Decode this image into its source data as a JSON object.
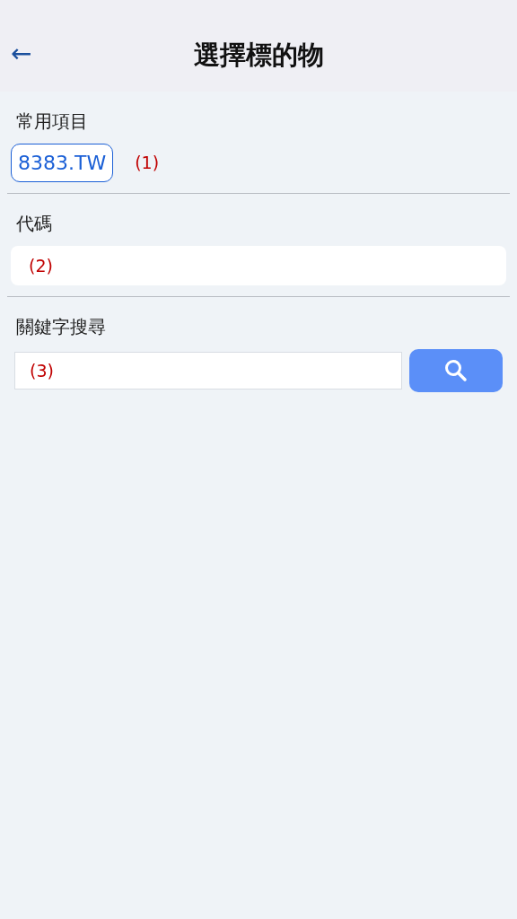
{
  "header": {
    "back": "←",
    "title": "選擇標的物"
  },
  "favorites": {
    "label": "常用項目",
    "chips": [
      {
        "label": "8383.TW"
      }
    ],
    "annotation": "(1)"
  },
  "code": {
    "label": "代碼",
    "value": "(2)"
  },
  "keyword": {
    "label": "關鍵字搜尋",
    "value": "(3)"
  }
}
